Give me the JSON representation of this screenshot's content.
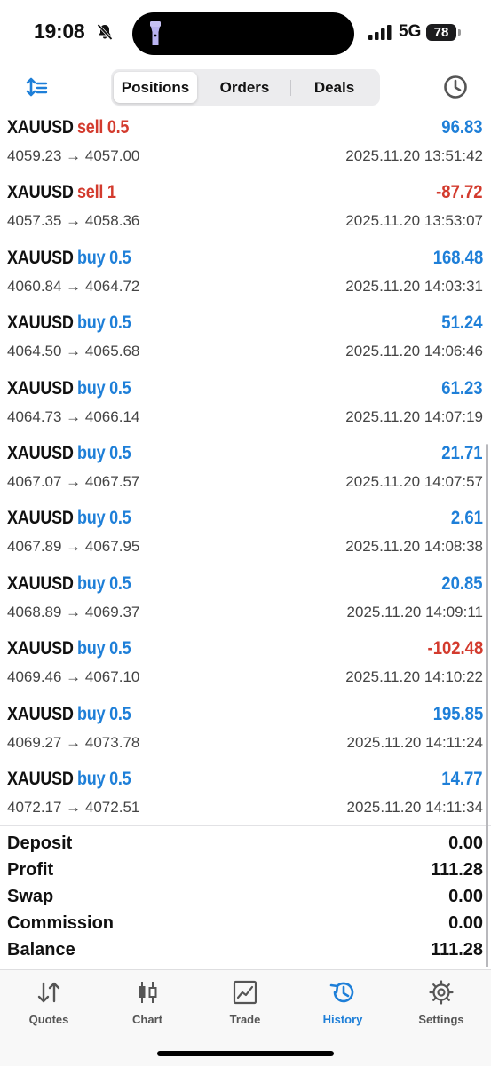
{
  "status_bar": {
    "time": "19:08",
    "network": "5G",
    "battery": "78",
    "icons": [
      "bell-slash-icon",
      "flashlight-icon",
      "signal-icon"
    ]
  },
  "toolbar": {
    "sort_icon": "sort-icon",
    "tabs": [
      "Positions",
      "Orders",
      "Deals"
    ],
    "active_tab": "Positions",
    "history_icon": "clock-icon"
  },
  "deals": [
    {
      "symbol": "XAUUSD",
      "side": "sell",
      "volume": "0.5",
      "prices": "4059.23 → 4057.00",
      "profit": "96.83",
      "datetime": "2025.11.20 13:51:42"
    },
    {
      "symbol": "XAUUSD",
      "side": "sell",
      "volume": "1",
      "prices": "4057.35 → 4058.36",
      "profit": "-87.72",
      "datetime": "2025.11.20 13:53:07"
    },
    {
      "symbol": "XAUUSD",
      "side": "buy",
      "volume": "0.5",
      "prices": "4060.84 → 4064.72",
      "profit": "168.48",
      "datetime": "2025.11.20 14:03:31"
    },
    {
      "symbol": "XAUUSD",
      "side": "buy",
      "volume": "0.5",
      "prices": "4064.50 → 4065.68",
      "profit": "51.24",
      "datetime": "2025.11.20 14:06:46"
    },
    {
      "symbol": "XAUUSD",
      "side": "buy",
      "volume": "0.5",
      "prices": "4064.73 → 4066.14",
      "profit": "61.23",
      "datetime": "2025.11.20 14:07:19"
    },
    {
      "symbol": "XAUUSD",
      "side": "buy",
      "volume": "0.5",
      "prices": "4067.07 → 4067.57",
      "profit": "21.71",
      "datetime": "2025.11.20 14:07:57"
    },
    {
      "symbol": "XAUUSD",
      "side": "buy",
      "volume": "0.5",
      "prices": "4067.89 → 4067.95",
      "profit": "2.61",
      "datetime": "2025.11.20 14:08:38"
    },
    {
      "symbol": "XAUUSD",
      "side": "buy",
      "volume": "0.5",
      "prices": "4068.89 → 4069.37",
      "profit": "20.85",
      "datetime": "2025.11.20 14:09:11"
    },
    {
      "symbol": "XAUUSD",
      "side": "buy",
      "volume": "0.5",
      "prices": "4069.46 → 4067.10",
      "profit": "-102.48",
      "datetime": "2025.11.20 14:10:22"
    },
    {
      "symbol": "XAUUSD",
      "side": "buy",
      "volume": "0.5",
      "prices": "4069.27 → 4073.78",
      "profit": "195.85",
      "datetime": "2025.11.20 14:11:24"
    },
    {
      "symbol": "XAUUSD",
      "side": "buy",
      "volume": "0.5",
      "prices": "4072.17 → 4072.51",
      "profit": "14.77",
      "datetime": "2025.11.20 14:11:34"
    }
  ],
  "summary": [
    {
      "label": "Deposit",
      "value": "0.00"
    },
    {
      "label": "Profit",
      "value": "111.28"
    },
    {
      "label": "Swap",
      "value": "0.00"
    },
    {
      "label": "Commission",
      "value": "0.00"
    },
    {
      "label": "Balance",
      "value": "111.28"
    }
  ],
  "tabbar": {
    "items": [
      {
        "label": "Quotes",
        "icon": "quotes-icon"
      },
      {
        "label": "Chart",
        "icon": "chart-icon"
      },
      {
        "label": "Trade",
        "icon": "trade-icon"
      },
      {
        "label": "History",
        "icon": "history-icon"
      },
      {
        "label": "Settings",
        "icon": "settings-icon"
      }
    ],
    "active": "History"
  },
  "colors": {
    "sell": "#d33b2e",
    "buy": "#1e7fd8",
    "profit_positive": "#1e7fd8",
    "profit_negative": "#d33b2e",
    "active_tab": "#1e7fd8"
  }
}
